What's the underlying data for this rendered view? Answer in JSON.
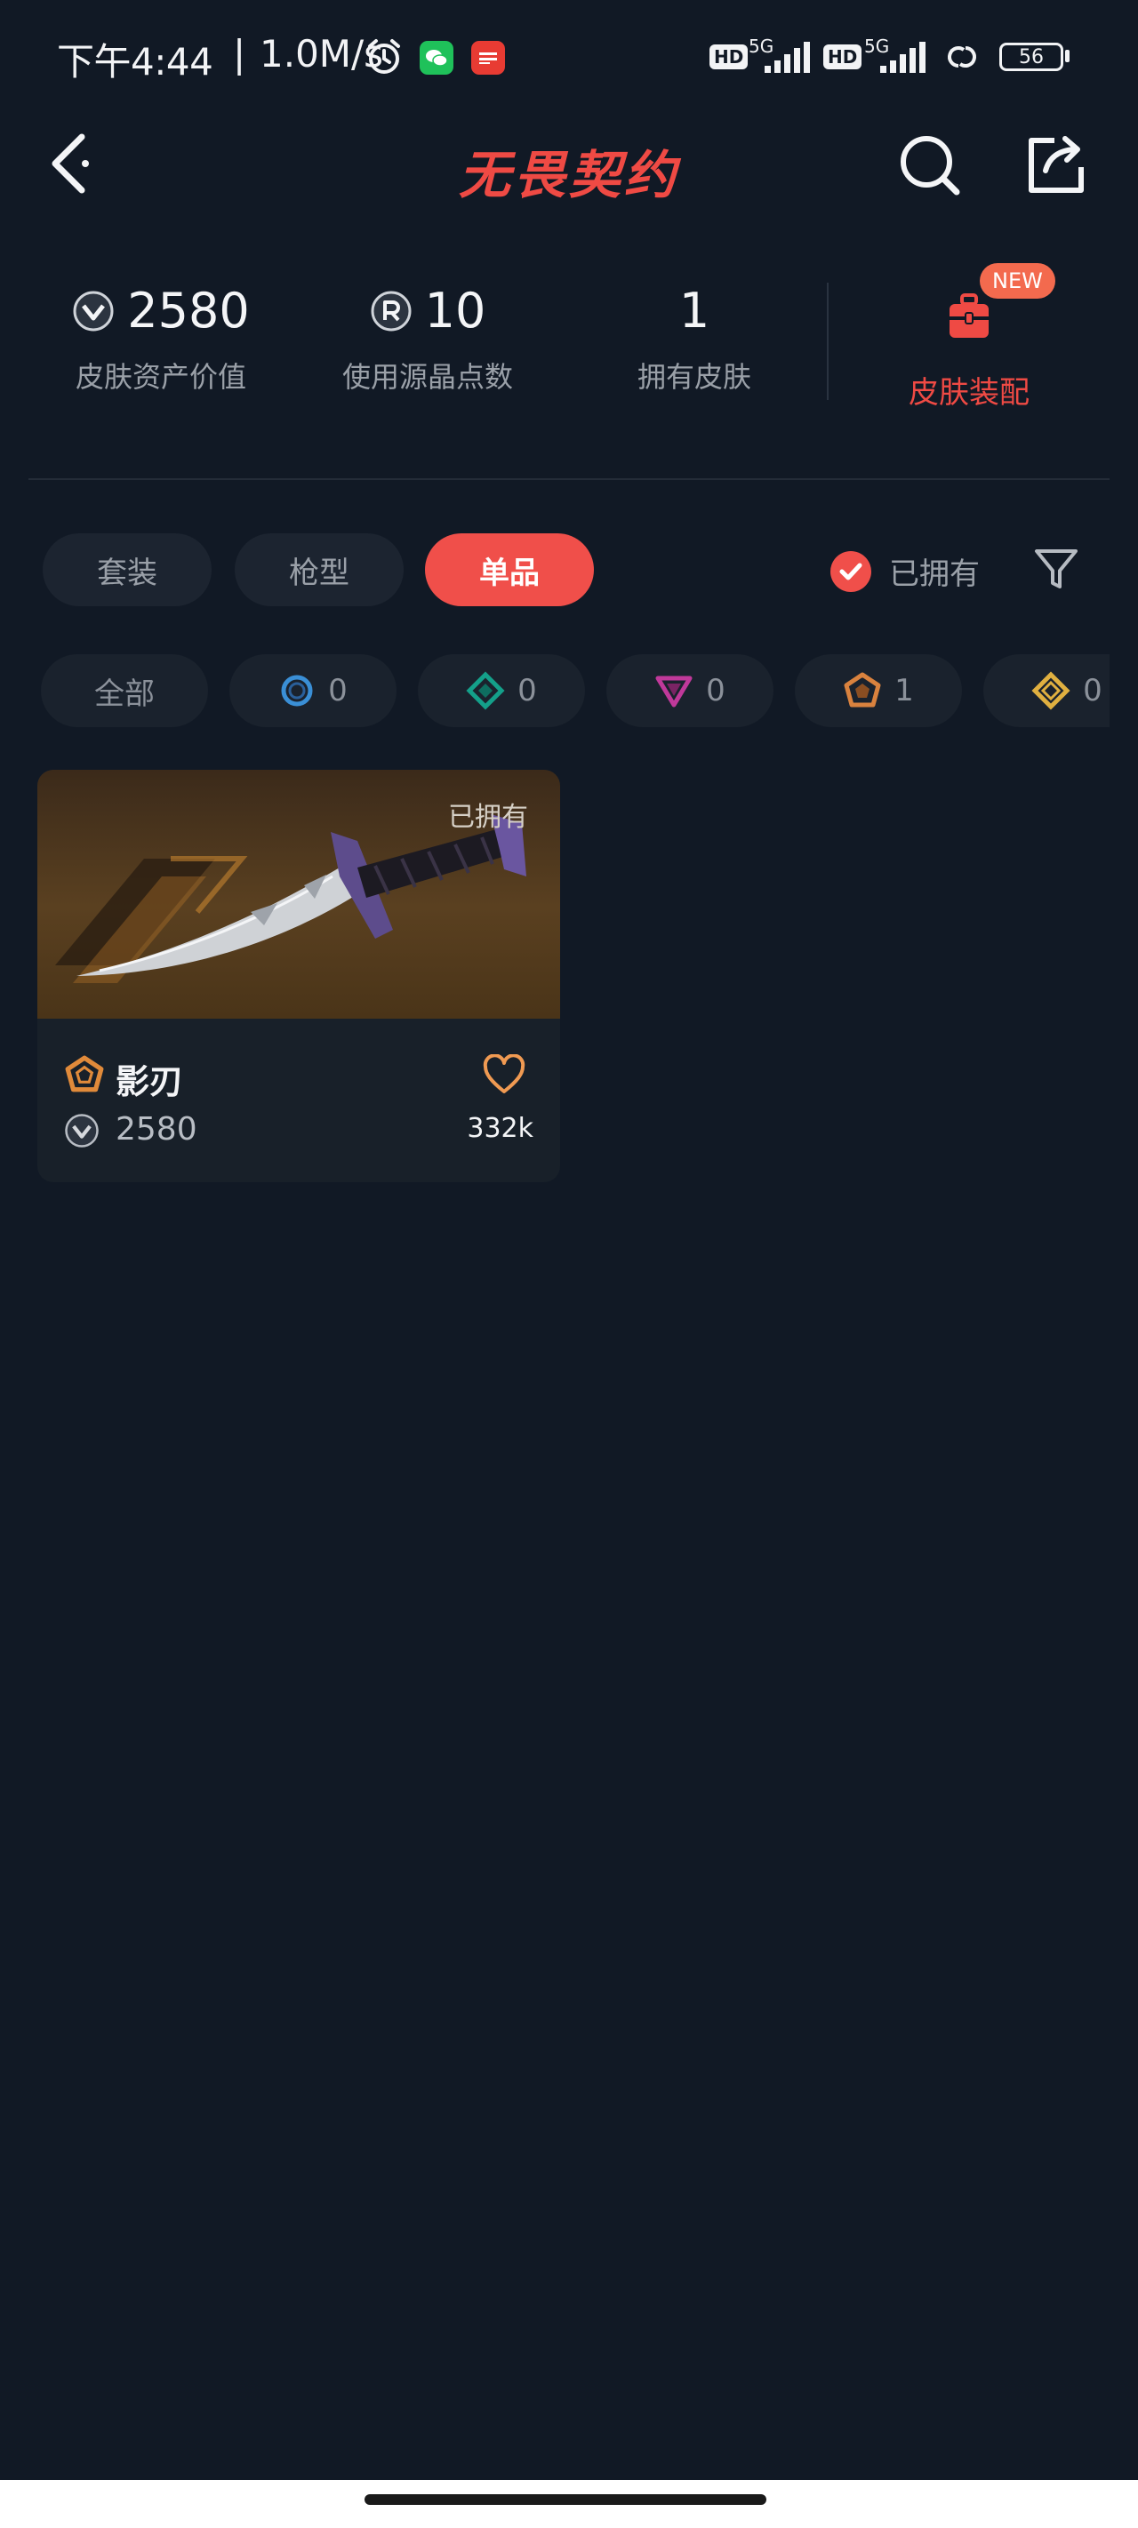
{
  "status_bar": {
    "time": "下午4:44",
    "separator": "|",
    "speed": "1.0M/s",
    "hd1": "HD",
    "net1": "5G",
    "hd2": "HD",
    "net2": "5G",
    "battery": "56"
  },
  "header": {
    "title": "无畏契约",
    "back_icon": "chevron-left-icon",
    "search_icon": "search-icon",
    "share_icon": "share-icon"
  },
  "stats": [
    {
      "value": "2580",
      "label": "皮肤资产价值",
      "icon": "vp-coin-icon"
    },
    {
      "value": "10",
      "label": "使用源晶点数",
      "icon": "radianite-icon"
    },
    {
      "value": "1",
      "label": "拥有皮肤"
    }
  ],
  "equip": {
    "label": "皮肤装配",
    "badge": "NEW",
    "icon": "backpack-icon"
  },
  "tabs": [
    {
      "label": "套装",
      "active": false
    },
    {
      "label": "枪型",
      "active": false
    },
    {
      "label": "单品",
      "active": true
    }
  ],
  "owned_filter": {
    "label": "已拥有",
    "checked": true
  },
  "tier_chips": [
    {
      "label": "全部",
      "count": null
    },
    {
      "tier": "select",
      "count": "0",
      "color": "#3a8fd6"
    },
    {
      "tier": "deluxe",
      "count": "0",
      "color": "#14a08a"
    },
    {
      "tier": "premium",
      "count": "0",
      "color": "#c0399a"
    },
    {
      "tier": "exclusive",
      "count": "1",
      "color": "#d9823e"
    },
    {
      "tier": "ultra",
      "count": "0",
      "color": "#e0b040"
    }
  ],
  "items": [
    {
      "name": "影刃",
      "price": "2580",
      "likes": "332k",
      "owned_label": "已拥有",
      "tier_color": "#e08a3a"
    }
  ],
  "colors": {
    "accent": "#f04f4a",
    "background": "#111925"
  }
}
